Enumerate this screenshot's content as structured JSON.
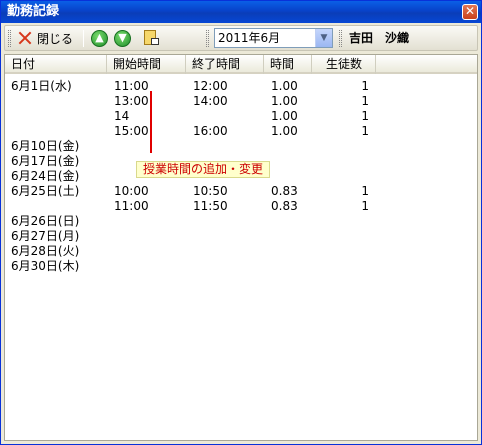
{
  "window": {
    "title": "勤務記録",
    "close_glyph": "✕"
  },
  "toolbar": {
    "close_label": "閉じる",
    "up_icon": "arrow-up-circle-icon",
    "down_icon": "arrow-down-circle-icon",
    "edit_icon": "edit-document-icon",
    "month": "2011年6月",
    "month_options": [
      "2011年6月"
    ],
    "student_name": "吉田　沙織"
  },
  "table": {
    "headers": [
      "日付",
      "開始時間",
      "終了時間",
      "時間",
      "生徒数"
    ],
    "rows": [
      {
        "date": "6月1日(水)",
        "start": "11:00",
        "end": "12:00",
        "hours": "1.00",
        "count": "1"
      },
      {
        "date": "",
        "start": "13:00",
        "end": "14:00",
        "hours": "1.00",
        "count": "1"
      },
      {
        "date": "",
        "start": "14",
        "end": "",
        "hours": "1.00",
        "count": "1"
      },
      {
        "date": "",
        "start": "15:00",
        "end": "16:00",
        "hours": "1.00",
        "count": "1"
      },
      {
        "date": "6月10日(金)",
        "start": "",
        "end": "",
        "hours": "",
        "count": ""
      },
      {
        "date": "6月17日(金)",
        "start": "",
        "end": "",
        "hours": "",
        "count": ""
      },
      {
        "date": "6月24日(金)",
        "start": "",
        "end": "",
        "hours": "",
        "count": ""
      },
      {
        "date": "6月25日(土)",
        "start": "10:00",
        "end": "10:50",
        "hours": "0.83",
        "count": "1"
      },
      {
        "date": "",
        "start": "11:00",
        "end": "11:50",
        "hours": "0.83",
        "count": "1"
      },
      {
        "date": "6月26日(日)",
        "start": "",
        "end": "",
        "hours": "",
        "count": ""
      },
      {
        "date": "6月27日(月)",
        "start": "",
        "end": "",
        "hours": "",
        "count": ""
      },
      {
        "date": "6月28日(火)",
        "start": "",
        "end": "",
        "hours": "",
        "count": ""
      },
      {
        "date": "6月30日(木)",
        "start": "",
        "end": "",
        "hours": "",
        "count": ""
      }
    ]
  },
  "tooltip": {
    "text": "授業時間の追加・変更"
  },
  "colors": {
    "titlebar": "#0A3DB8",
    "tooltip_text": "#CC0000",
    "tooltip_bg": "#FFFFCC"
  }
}
